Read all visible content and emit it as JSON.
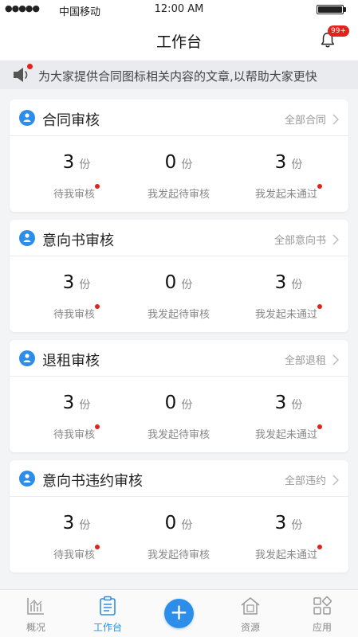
{
  "status_bar": {
    "signal": "●●●●●",
    "carrier": "中国移动",
    "time": "12:00 AM"
  },
  "nav": {
    "title": "工作台",
    "badge": "99+",
    "bell_icon": "bell-icon"
  },
  "notice": {
    "text": "为大家提供合同图标相关内容的文章,以帮助大家更快",
    "icon": "speaker-icon"
  },
  "colors": {
    "accent": "#2c8ee8",
    "alert": "#e2231a",
    "background": "#f3f4f6"
  },
  "cards": [
    {
      "title": "合同审核",
      "link": "全部合同",
      "stats": [
        {
          "value": "3",
          "unit": "份",
          "label": "待我审核",
          "dot": true
        },
        {
          "value": "0",
          "unit": "份",
          "label": "我发起待审核",
          "dot": false
        },
        {
          "value": "3",
          "unit": "份",
          "label": "我发起未通过",
          "dot": true
        }
      ]
    },
    {
      "title": "意向书审核",
      "link": "全部意向书",
      "stats": [
        {
          "value": "3",
          "unit": "份",
          "label": "待我审核",
          "dot": true
        },
        {
          "value": "0",
          "unit": "份",
          "label": "我发起待审核",
          "dot": false
        },
        {
          "value": "3",
          "unit": "份",
          "label": "我发起未通过",
          "dot": true
        }
      ]
    },
    {
      "title": "退租审核",
      "link": "全部退租",
      "stats": [
        {
          "value": "3",
          "unit": "份",
          "label": "待我审核",
          "dot": true
        },
        {
          "value": "0",
          "unit": "份",
          "label": "我发起待审核",
          "dot": false
        },
        {
          "value": "3",
          "unit": "份",
          "label": "我发起未通过",
          "dot": true
        }
      ]
    },
    {
      "title": "意向书违约审核",
      "link": "全部违约",
      "stats": [
        {
          "value": "3",
          "unit": "份",
          "label": "待我审核",
          "dot": true
        },
        {
          "value": "0",
          "unit": "份",
          "label": "我发起待审核",
          "dot": false
        },
        {
          "value": "3",
          "unit": "份",
          "label": "我发起未通过",
          "dot": true
        }
      ]
    }
  ],
  "tabbar": {
    "items": [
      {
        "label": "概况",
        "icon": "chart-icon"
      },
      {
        "label": "工作台",
        "icon": "clipboard-icon",
        "active": true
      },
      {
        "label": "资源",
        "icon": "house-icon"
      },
      {
        "label": "应用",
        "icon": "grid-icon"
      }
    ],
    "fab_symbol": "+"
  }
}
